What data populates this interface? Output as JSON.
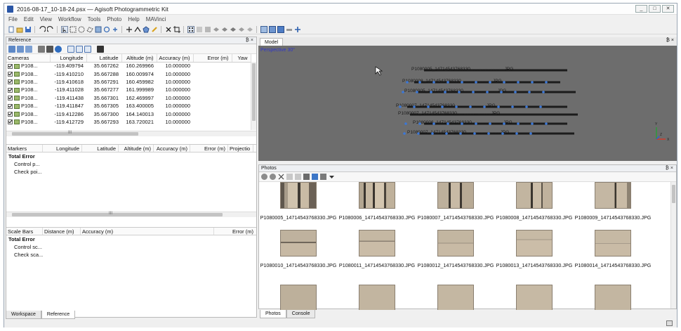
{
  "window": {
    "title": "2016-08-17_10-18-24.psx — Agisoft Photogrammetric Kit",
    "controls": [
      "_",
      "□",
      "✕"
    ]
  },
  "menubar": [
    "File",
    "Edit",
    "View",
    "Workflow",
    "Tools",
    "Photo",
    "Help",
    "MAVinci"
  ],
  "reference": {
    "title": "Reference",
    "pane_controls": "₿ ×",
    "cameras_table": {
      "headers": [
        "Cameras",
        "Longitude",
        "Latitude",
        "Altitude (m)",
        "Accuracy (m)",
        "Error (m)",
        "Yaw"
      ],
      "rows": [
        {
          "name": "P108...",
          "lon": "-119.409794",
          "lat": "35.667262",
          "alt": "160.269966",
          "acc": "10.000000"
        },
        {
          "name": "P108...",
          "lon": "-119.410210",
          "lat": "35.667288",
          "alt": "160.009974",
          "acc": "10.000000"
        },
        {
          "name": "P108...",
          "lon": "-119.410618",
          "lat": "35.667291",
          "alt": "160.459982",
          "acc": "10.000000"
        },
        {
          "name": "P108...",
          "lon": "-119.411028",
          "lat": "35.667277",
          "alt": "161.999989",
          "acc": "10.000000"
        },
        {
          "name": "P108...",
          "lon": "-119.411438",
          "lat": "35.667301",
          "alt": "162.469997",
          "acc": "10.000000"
        },
        {
          "name": "P108...",
          "lon": "-119.411847",
          "lat": "35.667305",
          "alt": "163.400005",
          "acc": "10.000000"
        },
        {
          "name": "P108...",
          "lon": "-119.412286",
          "lat": "35.667300",
          "alt": "164.140013",
          "acc": "10.000000"
        },
        {
          "name": "P108...",
          "lon": "-119.412729",
          "lat": "35.667293",
          "alt": "163.720021",
          "acc": "10.000000"
        }
      ]
    },
    "markers_table": {
      "headers": [
        "Markers",
        "Longitude",
        "Latitude",
        "Altitude (m)",
        "Accuracy (m)",
        "Error (m)",
        "Projectio"
      ],
      "total": "Total Error",
      "items": [
        "Control p...",
        "Check poi..."
      ]
    },
    "scalebars_table": {
      "headers": [
        "Scale Bars",
        "Distance (m)",
        "Accuracy (m)",
        "Error (m)"
      ],
      "total": "Total Error",
      "items": [
        "Control sc...",
        "Check sca..."
      ]
    },
    "scroll_grip": "III",
    "bottom_tabs": [
      "Workspace",
      "Reference"
    ]
  },
  "model": {
    "tab": "Model",
    "view_label": "Perspective 30°",
    "pane_controls": "₿ ×"
  },
  "photos": {
    "title": "Photos",
    "pane_controls": "₿ ×",
    "row1": [
      "P1080005_14714543768330.JPG",
      "P1080006_14714543768330.JPG",
      "P1080007_14714543768330.JPG",
      "P1080008_14714543768330.JPG",
      "P1080009_14714543768330.JPG"
    ],
    "row2": [
      "P1080010_14714543768330.JPG",
      "P1080011_14714543768330.JPG",
      "P1080012_14714543768330.JPG",
      "P1080013_14714543768330.JPG",
      "P1080014_14714543768330.JPG"
    ],
    "bottom_tabs": [
      "Photos",
      "Console"
    ]
  }
}
